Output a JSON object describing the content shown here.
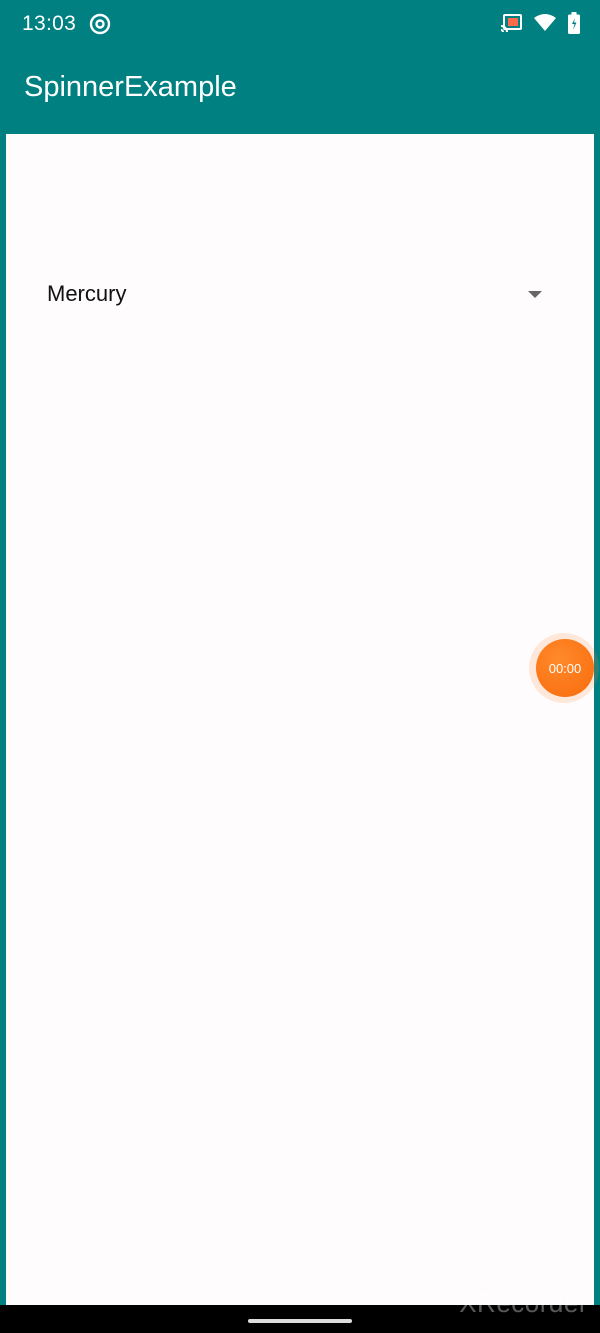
{
  "status_bar": {
    "time": "13:03",
    "icons": [
      "cast-icon",
      "wifi-icon",
      "battery-icon"
    ],
    "app_icon": "at-sign-icon"
  },
  "toolbar": {
    "title": "SpinnerExample"
  },
  "spinner": {
    "selected_value": "Mercury"
  },
  "recorder": {
    "timer": "00:00",
    "watermark": "XRecorder"
  },
  "colors": {
    "primary": "#008080",
    "accent": "#f96a0c",
    "background": "#fffcfd"
  }
}
